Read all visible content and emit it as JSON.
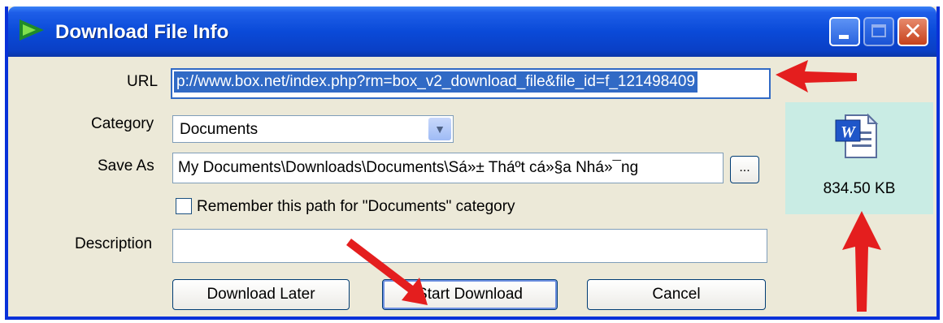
{
  "window": {
    "title": "Download File Info"
  },
  "titlebar": {
    "minimize": "minimize",
    "maximize": "maximize",
    "close": "close"
  },
  "form": {
    "url_label": "URL",
    "url_value": "p://www.box.net/index.php?rm=box_v2_download_file&file_id=f_121498409",
    "category_label": "Category",
    "category_value": "Documents",
    "save_as_label": "Save As",
    "save_as_value": "My Documents\\Downloads\\Documents\\Sá»± Tháº­t cá»§a Nhá»¯ng",
    "browse_label": "...",
    "remember_label": "Remember this path for \"Documents\" category",
    "description_label": "Description",
    "description_value": ""
  },
  "buttons": {
    "download_later": "Download Later",
    "start_download": "Start Download",
    "cancel": "Cancel"
  },
  "file_info": {
    "size": "834.50  KB",
    "icon": "word-document-icon"
  },
  "colors": {
    "titlebar": "#0a4ad8",
    "selection": "#316ac5",
    "panel": "#c9ece4",
    "arrow": "#e41e1e"
  }
}
